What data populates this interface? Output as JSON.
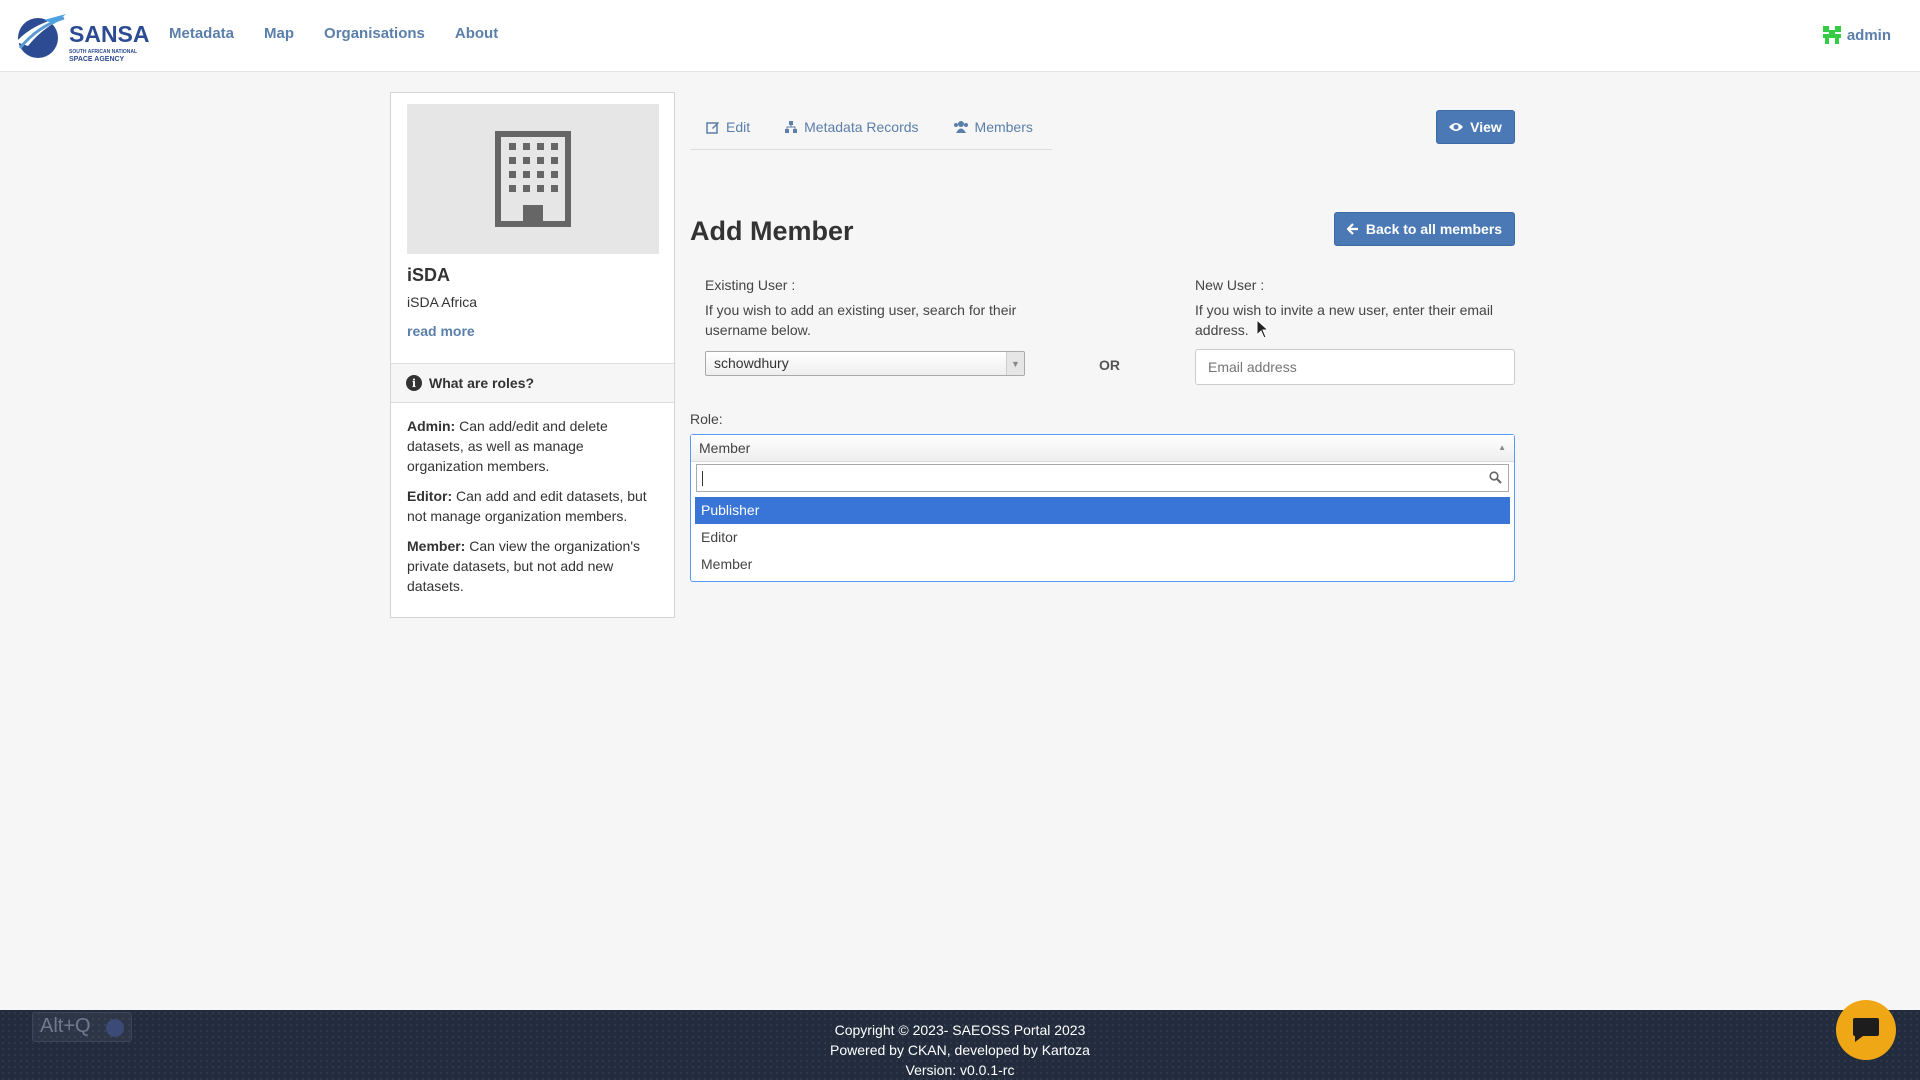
{
  "header": {
    "logo_text": "SANSA",
    "logo_sub_line1": "SOUTH AFRICAN NATIONAL",
    "logo_sub_line2": "SPACE AGENCY",
    "nav": [
      "Metadata",
      "Map",
      "Organisations",
      "About"
    ],
    "user": "admin"
  },
  "sidebar": {
    "org_title": "iSDA",
    "org_desc": "iSDA Africa",
    "read_more": "read more",
    "roles_heading": "What are roles?",
    "roles": [
      {
        "name": "Admin:",
        "text": " Can add/edit and delete datasets, as well as manage organization members."
      },
      {
        "name": "Editor:",
        "text": " Can add and edit datasets, but not manage organization members."
      },
      {
        "name": "Member:",
        "text": " Can view the organization's private datasets, but not add new datasets."
      }
    ]
  },
  "tabs": [
    "Edit",
    "Metadata Records",
    "Members"
  ],
  "view_button": "View",
  "back_button": "Back to all members",
  "page_title": "Add Member",
  "existing_user": {
    "label": "Existing User :",
    "help": "If you wish to add an existing user, search for their username below.",
    "value": "schowdhury"
  },
  "or_label": "OR",
  "new_user": {
    "label": "New User :",
    "help": "If you wish to invite a new user, enter their email address.",
    "placeholder": "Email address"
  },
  "role": {
    "label": "Role:",
    "selected": "Member",
    "options": [
      "Publisher",
      "Editor",
      "Member"
    ],
    "highlighted_index": 0
  },
  "footer": {
    "line1": "Copyright © 2023- SAEOSS Portal 2023",
    "line2": "Powered by CKAN, developed by Kartoza",
    "line3": "Version: v0.0.1-rc"
  },
  "altq_label": "Alt+Q",
  "colors": {
    "link": "#5b7fa9",
    "primary_button": "#4b79b5",
    "highlight": "#3875d7",
    "footer_bg": "#222c3d",
    "chat_button": "#f0a716"
  }
}
